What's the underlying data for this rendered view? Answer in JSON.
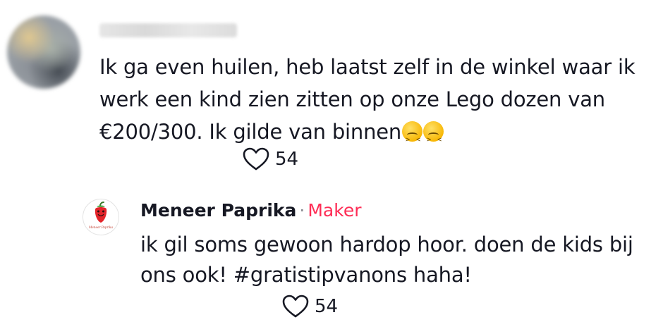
{
  "comment": {
    "username": "",
    "text": "Ik ga even huilen, heb laatst zelf in de winkel waar ik werk een kind zien zitten op onze Lego dozen van €200/300. Ik gilde van binnen",
    "emojis": [
      "confounded-face-emoji",
      "confounded-face-emoji"
    ],
    "likes": "54"
  },
  "reply": {
    "author": "Meneer Paprika",
    "separator": "·",
    "badge": "Maker",
    "text": "ik gil soms gewoon hardop hoor. doen de kids bij ons ook! #gratistipvanons haha!",
    "likes": "54",
    "avatar_text": "Meneer Paprika"
  },
  "colors": {
    "text": "#161823",
    "badge": "#fe2c55",
    "muted": "#8a8b91",
    "pepper": "#e4252b"
  }
}
